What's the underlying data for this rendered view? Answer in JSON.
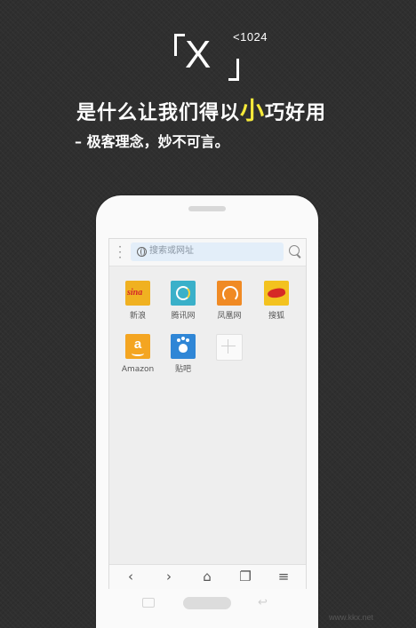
{
  "promo": {
    "logo_letter": "X",
    "logo_superscript": "<1024",
    "headline_before": "是什么让我们得以",
    "headline_highlight": "小",
    "headline_after": "巧好用",
    "subline": "– 极客理念，妙不可言。",
    "highlight_color": "#f6ea3a"
  },
  "browser": {
    "search_placeholder": "搜索或网址",
    "shortcuts": [
      {
        "label": "新浪",
        "icon": "sina-icon",
        "glyph": "sina"
      },
      {
        "label": "腾讯网",
        "icon": "tencent-icon"
      },
      {
        "label": "凤凰网",
        "icon": "ifeng-icon"
      },
      {
        "label": "搜狐",
        "icon": "sohu-icon"
      },
      {
        "label": "Amazon",
        "icon": "amazon-icon",
        "glyph": "a"
      },
      {
        "label": "贴吧",
        "icon": "tieba-icon",
        "glyph": "du"
      },
      {
        "label": "",
        "icon": "add-icon"
      }
    ],
    "nav": {
      "back": "‹",
      "forward": "›",
      "home": "⌂",
      "tabs": "❐",
      "menu": "≡"
    }
  },
  "watermark": "www.kkx.net"
}
